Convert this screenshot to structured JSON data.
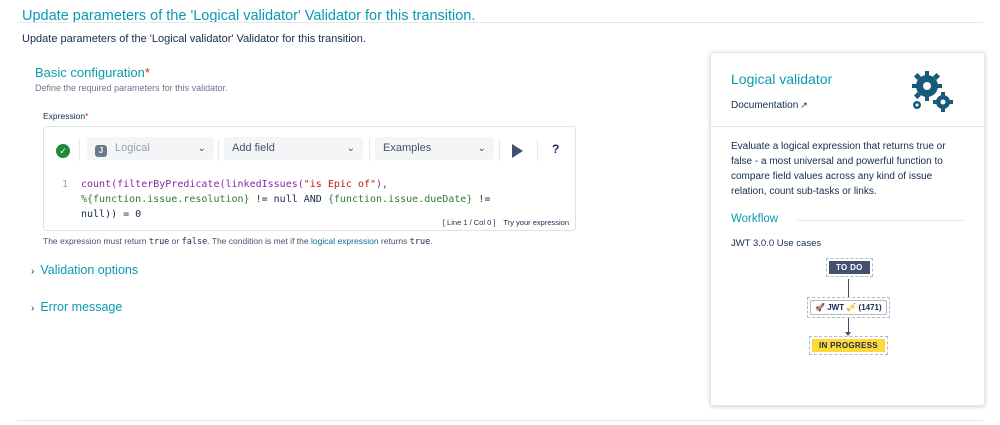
{
  "page": {
    "title": "Update parameters of the 'Logical validator' Validator for this transition.",
    "intro": "Update parameters of the 'Logical validator' Validator for this transition."
  },
  "basic": {
    "title": "Basic configuration",
    "required_mark": "*",
    "subtitle": "Define the required parameters for this validator."
  },
  "expression": {
    "label": "Expression",
    "required_mark": "*",
    "toolbar": {
      "status_icon": "check-circle-icon",
      "mode_select": "Logical",
      "field_select": "Add field",
      "examples_select": "Examples",
      "help_label": "?"
    },
    "line_number": "1",
    "code": {
      "l1_fn": "count(filterByPredicate(linkedIssues(",
      "l1_str": "\"is Epic of\"",
      "l1_end": "),",
      "l2_f1": "%{function.issue.resolution}",
      "l2_mid": " != null AND ",
      "l2_f2": "{function.issue.dueDate}",
      "l2_end": " !=",
      "l3": "null)) = 0"
    },
    "status": "[ Line 1 / Col 0 ]",
    "try_label": "Try your expression"
  },
  "note": {
    "p1": "The expression must return ",
    "true_code": "true",
    "p2": " or ",
    "false_code": "false",
    "p3": ". The condition is met if the ",
    "link": "logical expression",
    "p4": " returns ",
    "true_code2": "true",
    "p5": "."
  },
  "sections": {
    "validation_options": "Validation options",
    "error_message": "Error message"
  },
  "card": {
    "title": "Logical validator",
    "documentation": "Documentation",
    "description": "Evaluate a logical expression that returns true or false - a most universal and powerful function to compare field values across any kind of issue relation, count sub-tasks or links.",
    "workflow_title": "Workflow",
    "use_cases": "JWT 3.0.0 Use cases",
    "diagram": {
      "from_status": "TO DO",
      "transition": "JWT",
      "transition_count": "(1471)",
      "to_status": "IN PROGRESS"
    }
  },
  "colors": {
    "accent": "#0a9ab0",
    "text": "#172b4d",
    "required": "#de350b",
    "success": "#1e8a3a",
    "todo_lozenge": "#42526e",
    "inprogress_lozenge": "#ffd93a"
  }
}
